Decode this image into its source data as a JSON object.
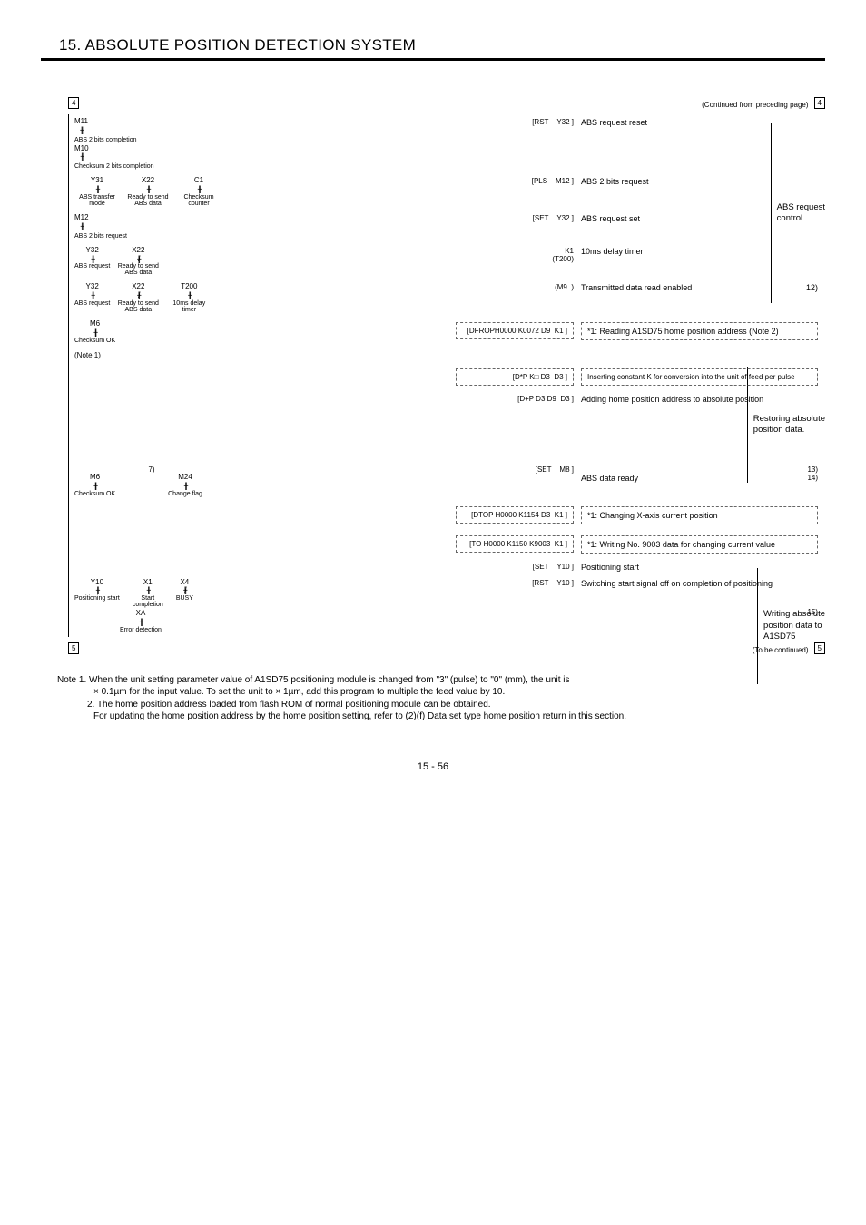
{
  "header": {
    "title": "15. ABSOLUTE POSITION DETECTION SYSTEM"
  },
  "top": {
    "continued": "(Continued from preceding page)",
    "box_label": "4"
  },
  "bottom": {
    "continued": "(To be continued)",
    "box_label": "5"
  },
  "right_groups": {
    "g1": "ABS request\ncontrol",
    "g2": "Restoring absolute\nposition data.",
    "g3": "Writing absolute\nposition data to\nA1SD75"
  },
  "rungs": [
    {
      "left": [
        {
          "dev": "M11",
          "sym": "-| |-",
          "desc": "ABS 2 bits completion"
        },
        {
          "dev": "M10",
          "sym": "-| |-",
          "desc": "Checksum 2 bits completion"
        }
      ],
      "instr": {
        "op": "RST",
        "arg": "Y32"
      },
      "comment": "ABS request reset"
    },
    {
      "left": [
        {
          "dev": "Y31",
          "sym": "-| |-",
          "desc": "ABS transfer mode"
        },
        {
          "dev": "X22",
          "sym": "-| |-",
          "desc": "Ready to send ABS data"
        },
        {
          "dev": "C1",
          "sym": "-| |-",
          "desc": "Checksum counter"
        }
      ],
      "instr": {
        "op": "PLS",
        "arg": "M12"
      },
      "comment": "ABS 2 bits request"
    },
    {
      "left": [
        {
          "dev": "M12",
          "sym": "-| |-",
          "desc": "ABS 2 bits request"
        }
      ],
      "instr": {
        "op": "SET",
        "arg": "Y32"
      },
      "comment": "ABS request set"
    },
    {
      "left": [
        {
          "dev": "Y32",
          "sym": "-| |-",
          "desc": "ABS request"
        },
        {
          "dev": "X22",
          "sym": "-|/|-",
          "desc": "Ready to send ABS data"
        }
      ],
      "instr": {
        "op": "K1",
        "arg": "T200"
      },
      "comment": "10ms delay timer"
    },
    {
      "left": [
        {
          "dev": "Y32",
          "sym": "-| |-",
          "desc": "ABS request"
        },
        {
          "dev": "X22",
          "sym": "-|/|-",
          "desc": "Ready to send ABS data"
        },
        {
          "dev": "T200",
          "sym": "-| |-",
          "desc": "10ms delay timer"
        }
      ],
      "instr": {
        "op": "",
        "arg": "M9"
      },
      "comment": "Transmitted data read enabled",
      "refnum": "12)"
    },
    {
      "left": [
        {
          "dev": "M6",
          "sym": "-| |-",
          "desc": "Checksum OK"
        }
      ],
      "note": "(Note 1)",
      "instr": {
        "op": "DFROPH0000 K0072 D9",
        "arg": "K1"
      },
      "comment": "*1: Reading A1SD75 home position address (Note 2)",
      "dashed": true
    },
    {
      "left": [],
      "instr": {
        "op": "D*P   K□   D3",
        "arg": "D3"
      },
      "comment": "Inserting constant K for conversion into the unit of feed per pulse",
      "dashed": true
    },
    {
      "left": [],
      "instr": {
        "op": "D+P   D3   D9",
        "arg": "D3"
      },
      "comment": "Adding home position address to absolute position"
    },
    {
      "left": [
        {
          "dev": "M6",
          "sym": "-| |-",
          "desc": "Checksum OK"
        },
        {
          "dev": "M24",
          "sym": "-| |-",
          "desc": "Change flag"
        }
      ],
      "refnum_left": "7)",
      "refnum": "13)",
      "instr": {
        "op": "SET",
        "arg": "M8"
      },
      "comment": "ABS data ready",
      "refnum2": "14)"
    },
    {
      "left": [],
      "instr": {
        "op": "DTOP H0000 K1154 D3",
        "arg": "K1"
      },
      "comment": "*1: Changing X-axis current position",
      "dashed": true
    },
    {
      "left": [],
      "instr": {
        "op": "TO    H0000 K1150 K9003",
        "arg": "K1"
      },
      "comment": "*1: Writing No. 9003 data for changing current value",
      "dashed": true
    },
    {
      "left": [],
      "instr": {
        "op": "SET",
        "arg": "Y10"
      },
      "comment": "Positioning start"
    },
    {
      "left": [
        {
          "dev": "Y10",
          "sym": "-| |-",
          "desc": "Positioning start"
        },
        {
          "dev": "X1",
          "sym": "-| |-",
          "desc": "Start completion"
        },
        {
          "dev": "X4",
          "sym": "-|/|-",
          "desc": "BUSY"
        },
        {
          "dev": "XA",
          "sym": "-| |-",
          "desc": "Error detection"
        }
      ],
      "instr": {
        "op": "RST",
        "arg": "Y10"
      },
      "comment": "Switching start signal off on completion of positioning",
      "refnum": "15)"
    }
  ],
  "notes": {
    "n1_lead": "Note 1.",
    "n1a": "When the unit setting parameter value of A1SD75 positioning module is changed from \"3\" (pulse) to \"0\" (mm), the unit is",
    "n1b": "× 0.1µm for the input value. To set the unit to × 1µm, add this program to multiple the feed value by 10.",
    "n2_lead": "2.",
    "n2a": "The home position address loaded from flash ROM of normal positioning module can be obtained.",
    "n2b": "For updating the home position address by the home position setting, refer to (2)(f) Data set type home position return in this section."
  },
  "pagenum": "15 -  56"
}
